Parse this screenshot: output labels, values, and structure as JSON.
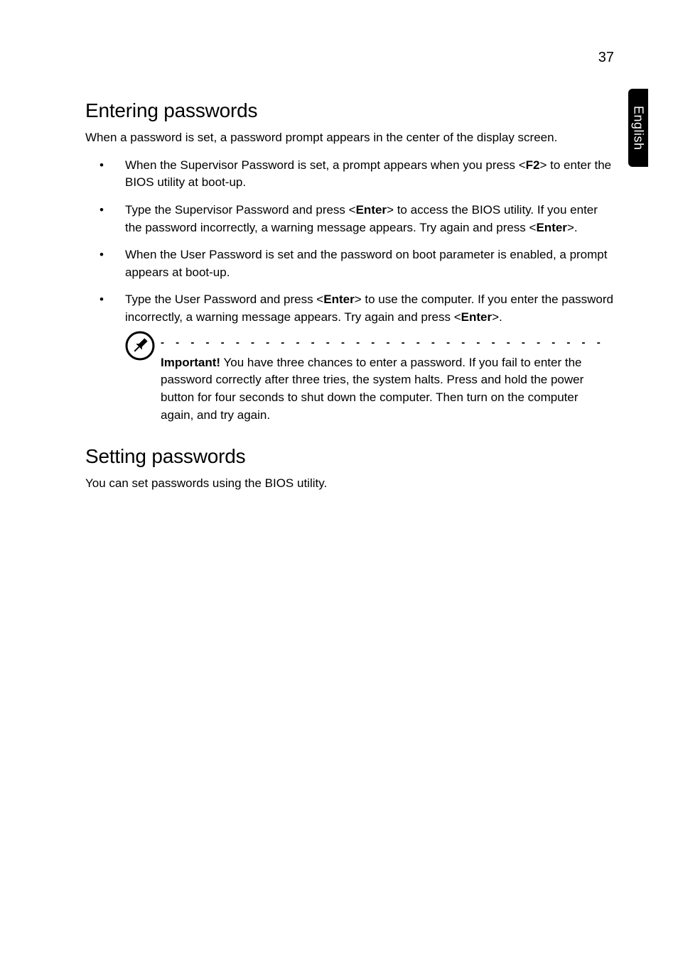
{
  "page_number": "37",
  "side_tab": "English",
  "sections": {
    "entering": {
      "heading": "Entering passwords",
      "intro": "When a password is set, a password prompt appears in the center of the display screen.",
      "bullets": {
        "b1_a": "When the Supervisor Password is set, a prompt appears when you press <",
        "b1_key": "F2",
        "b1_b": "> to enter the BIOS utility at boot-up.",
        "b2_a": "Type the Supervisor Password and press <",
        "b2_key1": "Enter",
        "b2_b": "> to access the BIOS utility. If you enter the password incorrectly, a warning message appears. Try again and press <",
        "b2_key2": "Enter",
        "b2_c": ">.",
        "b3": "When the User Password is set and the password on boot parameter is enabled, a prompt appears at boot-up.",
        "b4_a": "Type the User Password and press <",
        "b4_key1": "Enter",
        "b4_b": "> to use the computer. If you enter the password incorrectly, a warning message appears. Try again and press <",
        "b4_key2": "Enter",
        "b4_c": ">."
      },
      "note": {
        "important_label": "Important!",
        "text": " You have three chances to enter a password. If you fail to enter the password correctly after three tries, the system halts. Press and hold the power button for four seconds to shut down the computer. Then turn on the computer again, and try again."
      }
    },
    "setting": {
      "heading": "Setting passwords",
      "body": "You can set passwords using the BIOS utility."
    }
  },
  "dashes_line": "- - - - - - - - - - - - - - - - - - - - - - - - - - - - - - - - - - - - - - - - - - - - -"
}
